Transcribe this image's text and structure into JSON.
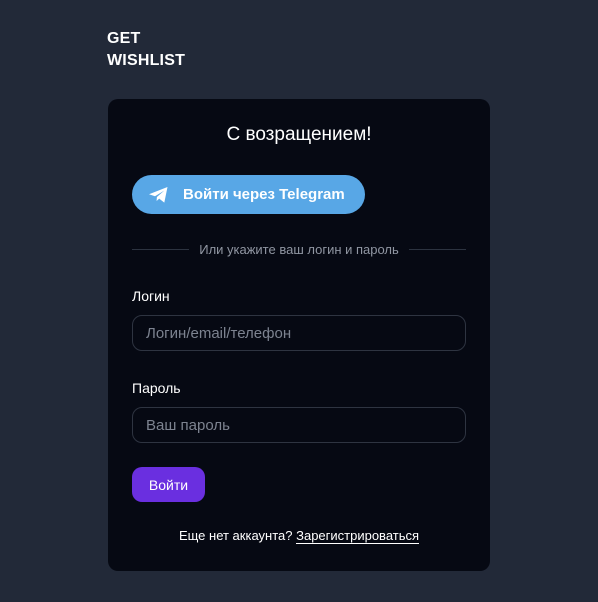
{
  "brand": {
    "line1": "GET",
    "line2": "WISHLIST"
  },
  "login_card": {
    "title": "С возращением!",
    "telegram_button": {
      "label": "Войти через Telegram",
      "icon": "telegram-plane-icon",
      "color": "#58a7e6"
    },
    "divider_text": "Или укажите ваш логин и пароль",
    "login_field": {
      "label": "Логин",
      "placeholder": "Логин/email/телефон",
      "value": ""
    },
    "password_field": {
      "label": "Пароль",
      "placeholder": "Ваш пароль",
      "value": ""
    },
    "submit_button": {
      "label": "Войти",
      "color": "#6a2fe0"
    },
    "footer": {
      "text": "Еще нет аккаунта?",
      "register_link": "Зарегистрироваться"
    }
  },
  "colors": {
    "page_background": "#222938",
    "card_background": "#060913"
  }
}
